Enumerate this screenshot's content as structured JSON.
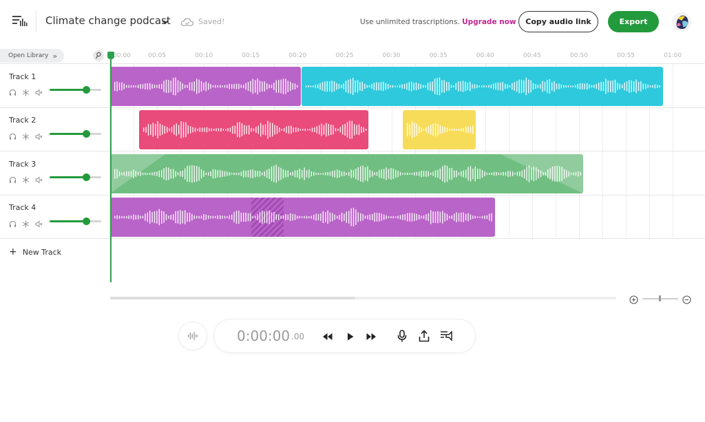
{
  "header": {
    "project_title": "Climate change podcast",
    "save_status": "Saved!",
    "upgrade_prompt": "Use unlimited trascriptions.",
    "upgrade_link": "Upgrade now",
    "copy_link_label": "Copy audio link",
    "export_label": "Export"
  },
  "library": {
    "open_label": "Open Library"
  },
  "timeline": {
    "ticks": [
      "00:00",
      "00:05",
      "00:10",
      "00:15",
      "00:20",
      "00:25",
      "00:30",
      "00:35",
      "00:40",
      "00:45",
      "00:50",
      "00:55",
      "01:00"
    ],
    "playhead_time": "00:00"
  },
  "tracks": [
    {
      "name": "Track 1",
      "volume": 0.7
    },
    {
      "name": "Track 2",
      "volume": 0.7
    },
    {
      "name": "Track 3",
      "volume": 0.7
    },
    {
      "name": "Track 4",
      "volume": 0.7
    }
  ],
  "new_track_label": "New Track",
  "transport": {
    "time_main": "0:00:00",
    "time_frac": ".00"
  },
  "colors": {
    "accent_green": "#239a3c",
    "upgrade_pink": "#c0268f",
    "clip_purple": "#b964c8",
    "clip_cyan": "#2ec9dc",
    "clip_pink": "#e94b7b",
    "clip_yellow": "#f7dc5a",
    "clip_green": "#71be82"
  },
  "icons": {
    "menu": "waveform-menu-icon",
    "project_dropdown": "chevron-down-icon",
    "cloud": "cloud-icon",
    "headphones": "headphones-icon",
    "effects": "snowflake-icon",
    "mute": "speaker-mute-icon",
    "zoom_in": "zoom-in-icon",
    "zoom_out": "zoom-out-icon",
    "rewind": "rewind-icon",
    "play": "play-icon",
    "fast_forward": "fast-forward-icon",
    "record": "microphone-icon",
    "share": "upload-icon",
    "transcript": "transcript-icon",
    "waveform": "waveform-icon"
  }
}
